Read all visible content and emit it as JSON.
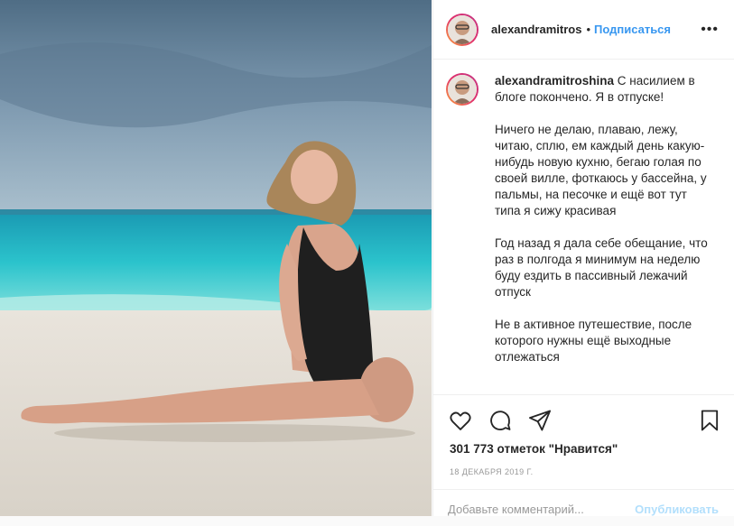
{
  "post": {
    "image_alt": "Woman in black swimsuit sitting on a tropical beach",
    "colors": {
      "accent": "#3897f0",
      "publish_disabled": "#b2dffc"
    }
  },
  "header": {
    "username": "alexandramitros",
    "separator": "•",
    "follow_label": "Подписаться",
    "more_icon": "more-horizontal-icon"
  },
  "caption": {
    "username": "alexandramitroshina",
    "text": " С насилием в блоге покончено. Я в отпуске!\n\nНичего не делаю, плаваю, лежу, читаю, сплю, ем каждый день какую-нибудь новую кухню, бегаю голая по своей вилле, фоткаюсь у бассейна, у пальмы, на песочке и ещё вот тут типа я сижу красивая\n\nГод назад я дала себе обещание, что раз в полгода я минимум на неделю буду ездить в пассивный лежачий отпуск\n\nНе в активное путешествие, после которого нужны ещё выходные отлежаться"
  },
  "actions": {
    "icons": [
      "heart-icon",
      "comment-icon",
      "share-icon",
      "bookmark-icon"
    ],
    "likes": "301 773 отметок \"Нравится\"",
    "date": "18 ДЕКАБРЯ 2019 Г."
  },
  "comment": {
    "placeholder": "Добавьте комментарий...",
    "publish_label": "Опубликовать"
  }
}
